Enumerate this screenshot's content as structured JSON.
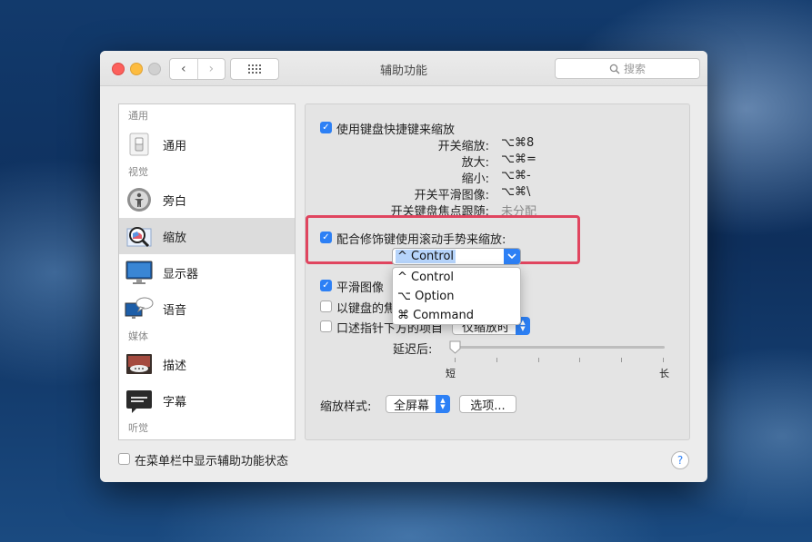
{
  "window": {
    "title": "辅助功能",
    "search_placeholder": "搜索",
    "back_glyph": "‹",
    "forward_glyph": "›"
  },
  "sidebar": {
    "headers": [
      "通用",
      "视觉",
      "媒体",
      "听觉"
    ],
    "items": [
      {
        "label": "通用",
        "icon": "general-switch-icon",
        "selected": false
      },
      {
        "label": "旁白",
        "icon": "voiceover-icon",
        "selected": false
      },
      {
        "label": "缩放",
        "icon": "zoom-magnifier-icon",
        "selected": true
      },
      {
        "label": "显示器",
        "icon": "display-icon",
        "selected": false
      },
      {
        "label": "语音",
        "icon": "speech-icon",
        "selected": false
      },
      {
        "label": "描述",
        "icon": "descriptions-icon",
        "selected": false
      },
      {
        "label": "字幕",
        "icon": "captions-icon",
        "selected": false
      }
    ]
  },
  "zoom": {
    "keyboard_shortcuts": {
      "label": "使用键盘快捷键来缩放",
      "checked": true
    },
    "shortcuts": [
      {
        "label": "开关缩放:",
        "key": "⌥⌘8"
      },
      {
        "label": "放大:",
        "key": "⌥⌘="
      },
      {
        "label": "缩小:",
        "key": "⌥⌘-"
      },
      {
        "label": "开关平滑图像:",
        "key": "⌥⌘\\"
      },
      {
        "label": "开关键盘焦点跟随:",
        "key": "未分配"
      }
    ],
    "scroll_gesture": {
      "label": "配合修饰键使用滚动手势来缩放:",
      "checked": true
    },
    "modifier_select": {
      "value": "^ Control"
    },
    "modifier_menu": [
      "^ Control",
      "⌥ Option",
      "⌘ Command"
    ],
    "smooth_images": {
      "label": "平滑图像",
      "checked": true
    },
    "keyboard_focus": {
      "label": "以键盘的焦",
      "checked": false
    },
    "speak_items": {
      "label": "口述指针下方的项目",
      "checked": false
    },
    "speak_popup_value": "仅缩放时",
    "delay_label": "延迟后:",
    "slider_min": "短",
    "slider_max": "长",
    "slider_value": 0,
    "style_label": "缩放样式:",
    "style_value": "全屏幕",
    "options_button": "选项..."
  },
  "footer": {
    "menu_bar_status": {
      "label": "在菜单栏中显示辅助功能状态",
      "checked": false
    },
    "help": "?"
  },
  "colors": {
    "accent": "#2d80f5",
    "highlight_box": "#e0455f",
    "selection": "#b6d4fb"
  }
}
